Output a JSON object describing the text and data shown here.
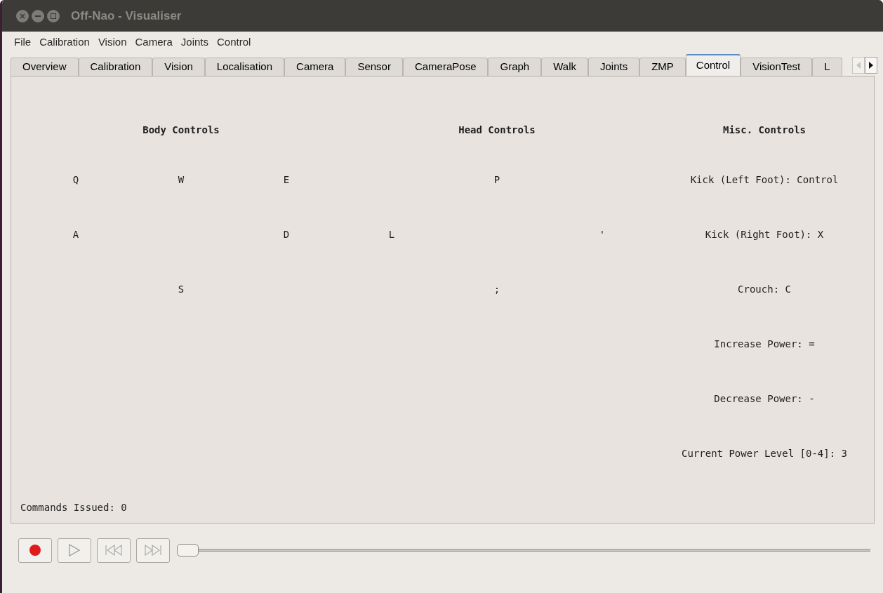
{
  "window": {
    "title": "Off-Nao - Visualiser"
  },
  "menu": [
    {
      "label": "File"
    },
    {
      "label": "Calibration"
    },
    {
      "label": "Vision"
    },
    {
      "label": "Camera"
    },
    {
      "label": "Joints"
    },
    {
      "label": "Control"
    }
  ],
  "tabs": [
    {
      "label": "Overview",
      "selected": false
    },
    {
      "label": "Calibration",
      "selected": false
    },
    {
      "label": "Vision",
      "selected": false
    },
    {
      "label": "Localisation",
      "selected": false
    },
    {
      "label": "Camera",
      "selected": false
    },
    {
      "label": "Sensor",
      "selected": false
    },
    {
      "label": "CameraPose",
      "selected": false
    },
    {
      "label": "Graph",
      "selected": false
    },
    {
      "label": "Walk",
      "selected": false
    },
    {
      "label": "Joints",
      "selected": false
    },
    {
      "label": "ZMP",
      "selected": false
    },
    {
      "label": "Control",
      "selected": true
    },
    {
      "label": "VisionTest",
      "selected": false
    },
    {
      "label": "L",
      "selected": false
    }
  ],
  "body_controls": {
    "title": "Body Controls",
    "rows": [
      [
        "Q",
        "W",
        "E"
      ],
      [
        "A",
        null,
        "D"
      ],
      [
        null,
        "S",
        null
      ]
    ]
  },
  "head_controls": {
    "title": "Head Controls",
    "rows": [
      [
        null,
        "P",
        null
      ],
      [
        "L",
        null,
        "'"
      ],
      [
        null,
        ";",
        null
      ]
    ]
  },
  "misc_controls": {
    "title": "Misc. Controls",
    "items": [
      "Kick (Left Foot): Control",
      "Kick (Right Foot): X",
      "Crouch: C",
      "Increase Power: =",
      "Decrease Power: -",
      "Current Power Level [0-4]: 3"
    ]
  },
  "commands_issued": "Commands Issued: 0",
  "playback": {
    "level": 0
  }
}
